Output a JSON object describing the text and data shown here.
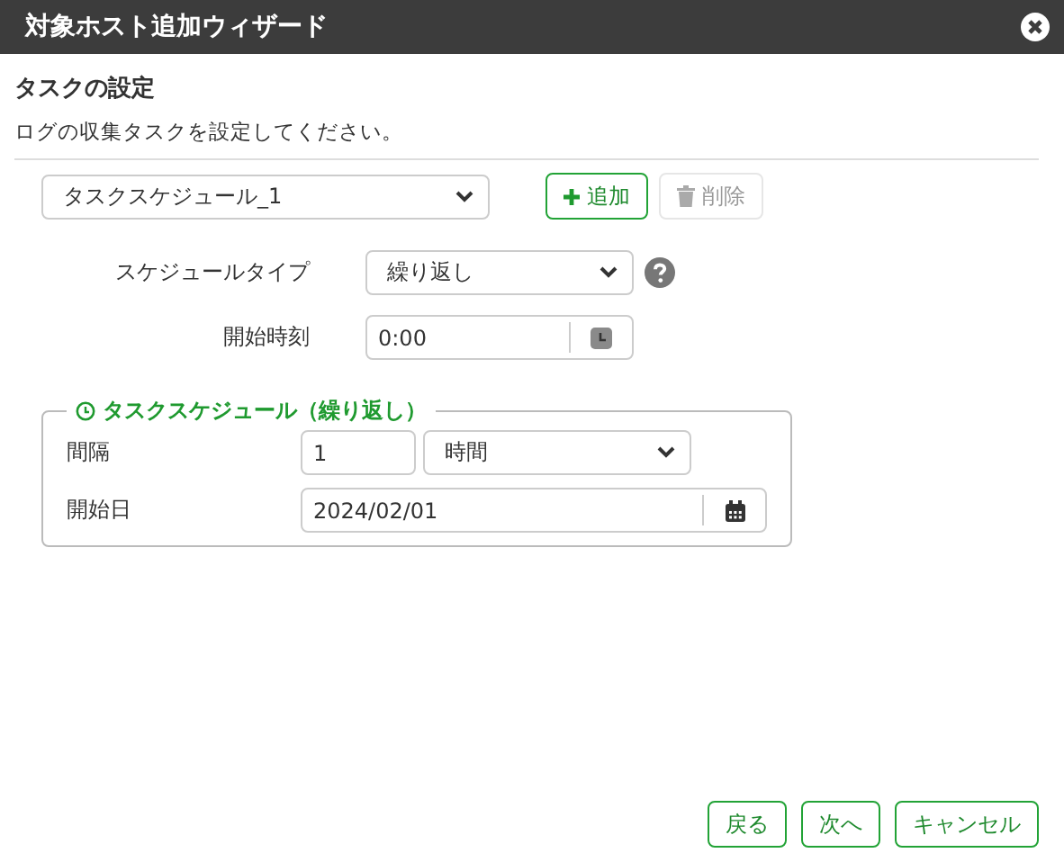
{
  "window": {
    "title": "対象ホスト追加ウィザード"
  },
  "section": {
    "title": "タスクの設定",
    "description": "ログの収集タスクを設定してください。"
  },
  "task_select": {
    "value": "タスクスケジュール_1"
  },
  "task_buttons": [
    {
      "label": "追加",
      "kind": "add",
      "disabled": false
    },
    {
      "label": "削除",
      "kind": "delete",
      "disabled": true
    }
  ],
  "schedule_type": {
    "label": "スケジュールタイプ",
    "value": "繰り返し"
  },
  "start_time": {
    "label": "開始時刻",
    "value": "0:00"
  },
  "schedule_group": {
    "legend": "タスクスケジュール（繰り返し）",
    "interval": {
      "label": "間隔",
      "value": "1",
      "unit": "時間"
    },
    "start_date": {
      "label": "開始日",
      "value": "2024/02/01"
    }
  },
  "buttons": [
    {
      "label": "戻る"
    },
    {
      "label": "次へ"
    },
    {
      "label": "キャンセル"
    }
  ]
}
